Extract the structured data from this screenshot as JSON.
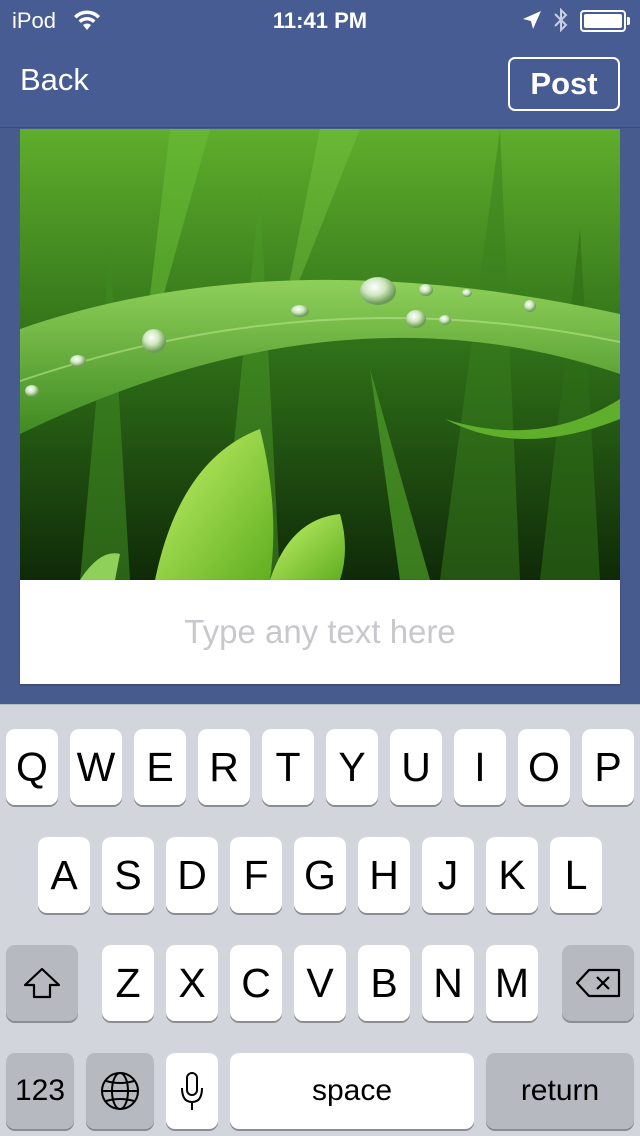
{
  "status_bar": {
    "carrier": "iPod",
    "time": "11:41 PM",
    "icons": [
      "wifi-icon",
      "location-arrow-icon",
      "bluetooth-icon",
      "battery-icon"
    ]
  },
  "nav": {
    "back_label": "Back",
    "post_label": "Post"
  },
  "photo": {
    "subject": "grass-with-dew-drops"
  },
  "caption": {
    "placeholder": "Type any text here",
    "value": ""
  },
  "keyboard": {
    "row1": [
      "Q",
      "W",
      "E",
      "R",
      "T",
      "Y",
      "U",
      "I",
      "O",
      "P"
    ],
    "row2": [
      "A",
      "S",
      "D",
      "F",
      "G",
      "H",
      "J",
      "K",
      "L"
    ],
    "row3": [
      "Z",
      "X",
      "C",
      "V",
      "B",
      "N",
      "M"
    ],
    "numbers_label": "123",
    "space_label": "space",
    "return_label": "return"
  },
  "colors": {
    "nav_background": "#475c92",
    "keyboard_background": "#d2d5db",
    "placeholder": "#c8c8cc"
  }
}
